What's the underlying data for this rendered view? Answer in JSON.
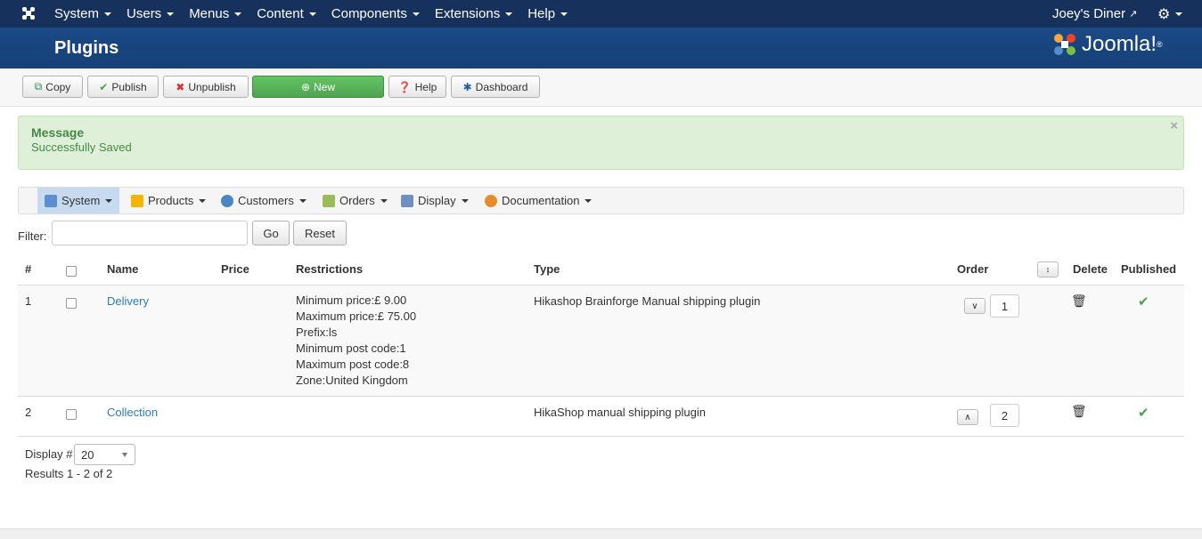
{
  "topnav": {
    "menu": [
      "System",
      "Users",
      "Menus",
      "Content",
      "Components",
      "Extensions",
      "Help"
    ],
    "site_name": "Joey's Diner"
  },
  "header": {
    "title": "Plugins",
    "brand": "Joomla!"
  },
  "toolbar": {
    "copy": "Copy",
    "publish": "Publish",
    "unpublish": "Unpublish",
    "new": "New",
    "help": "Help",
    "dashboard": "Dashboard"
  },
  "message": {
    "heading": "Message",
    "text": "Successfully Saved"
  },
  "submenu": [
    "System",
    "Products",
    "Customers",
    "Orders",
    "Display",
    "Documentation"
  ],
  "filter": {
    "label": "Filter:",
    "value": "",
    "go": "Go",
    "reset": "Reset"
  },
  "table": {
    "headers": {
      "num": "#",
      "name": "Name",
      "price": "Price",
      "restrictions": "Restrictions",
      "type": "Type",
      "order": "Order",
      "delete": "Delete",
      "published": "Published"
    },
    "rows": [
      {
        "num": "1",
        "name": "Delivery",
        "price": "",
        "restrictions": [
          "Minimum price:£ 9.00",
          "Maximum price:£ 75.00",
          "Prefix:ls",
          "Minimum post code:1",
          "Maximum post code:8",
          "Zone:United Kingdom"
        ],
        "type": "Hikashop Brainforge Manual shipping plugin",
        "order": "1",
        "published": true
      },
      {
        "num": "2",
        "name": "Collection",
        "price": "",
        "restrictions": [],
        "type": "HikaShop manual shipping plugin",
        "order": "2",
        "published": true
      }
    ]
  },
  "pagination": {
    "display_label": "Display #",
    "display_value": "20",
    "results": "Results 1 - 2 of 2"
  },
  "colors": {
    "topnav": "#17315d",
    "header": "#1a4a86",
    "success_bg": "#dff0d8",
    "link": "#2a7db8",
    "new_button": "#5bb75b"
  }
}
